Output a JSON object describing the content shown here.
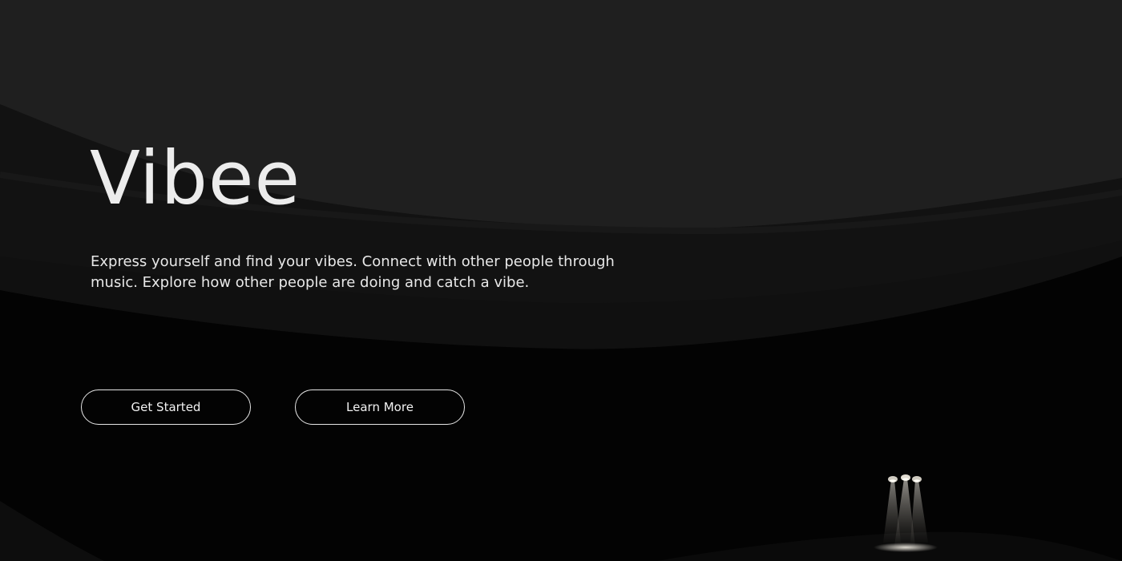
{
  "hero": {
    "title": "Vibee",
    "tagline": "Express yourself and find your vibes. Connect with other people through music. Explore how other people are doing and catch a vibe."
  },
  "actions": {
    "get_started_label": "Get Started",
    "learn_more_label": "Learn More"
  },
  "colors": {
    "background": "#030303",
    "upper_band": "#1f1f1f",
    "middle_band": "#111111",
    "text": "#ececec",
    "button_border": "#e6e6e6"
  },
  "decor": {
    "stage_icon": "spotlight-stage-icon"
  }
}
